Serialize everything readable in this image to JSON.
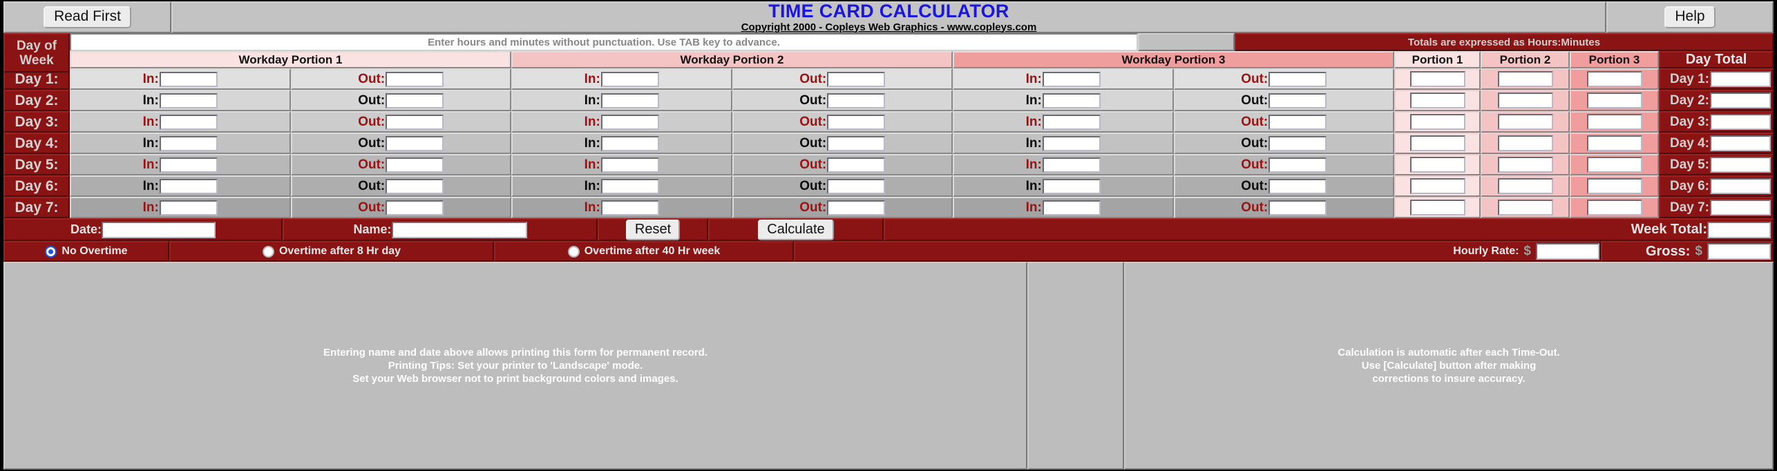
{
  "header": {
    "read_first_label": "Read First",
    "title": "TIME CARD CALCULATOR",
    "copyright": "Copyright 2000 - Copleys Web Graphics - www.copleys.com",
    "help_label": "Help",
    "title_color": "#1a16e0"
  },
  "instructions": {
    "entry_hint": "Enter hours and minutes without punctuation. Use TAB key to advance.",
    "totals_note": "Totals are expressed as Hours:Minutes"
  },
  "columns": {
    "day_of_week": "Day of\nWeek",
    "day_of_week_line1": "Day of",
    "day_of_week_line2": "Week",
    "workday_portions": [
      "Workday Portion 1",
      "Workday Portion 2",
      "Workday Portion 3"
    ],
    "portion_totals": [
      "Portion  1",
      "Portion  2",
      "Portion  3"
    ],
    "day_total": "Day Total",
    "in_label": "In:",
    "out_label": "Out:"
  },
  "rows": [
    {
      "day": "Day  1:",
      "total_label": "Day 1:",
      "label_style": "red",
      "bg": "#e0e0e0",
      "in1": "",
      "out1": "",
      "in2": "",
      "out2": "",
      "in3": "",
      "out3": "",
      "p1": "",
      "p2": "",
      "p3": "",
      "total": ""
    },
    {
      "day": "Day  2:",
      "total_label": "Day 2:",
      "label_style": "black",
      "bg": "#d6d6d6",
      "in1": "",
      "out1": "",
      "in2": "",
      "out2": "",
      "in3": "",
      "out3": "",
      "p1": "",
      "p2": "",
      "p3": "",
      "total": ""
    },
    {
      "day": "Day  3:",
      "total_label": "Day 3:",
      "label_style": "red",
      "bg": "#cccccc",
      "in1": "",
      "out1": "",
      "in2": "",
      "out2": "",
      "in3": "",
      "out3": "",
      "p1": "",
      "p2": "",
      "p3": "",
      "total": ""
    },
    {
      "day": "Day  4:",
      "total_label": "Day 4:",
      "label_style": "black",
      "bg": "#c2c2c2",
      "in1": "",
      "out1": "",
      "in2": "",
      "out2": "",
      "in3": "",
      "out3": "",
      "p1": "",
      "p2": "",
      "p3": "",
      "total": ""
    },
    {
      "day": "Day  5:",
      "total_label": "Day 5:",
      "label_style": "red",
      "bg": "#b8b8b8",
      "in1": "",
      "out1": "",
      "in2": "",
      "out2": "",
      "in3": "",
      "out3": "",
      "p1": "",
      "p2": "",
      "p3": "",
      "total": ""
    },
    {
      "day": "Day  6:",
      "total_label": "Day 6:",
      "label_style": "black",
      "bg": "#aeaeae",
      "in1": "",
      "out1": "",
      "in2": "",
      "out2": "",
      "in3": "",
      "out3": "",
      "p1": "",
      "p2": "",
      "p3": "",
      "total": ""
    },
    {
      "day": "Day  7:",
      "total_label": "Day 7:",
      "label_style": "red",
      "bg": "#a4a4a4",
      "in1": "",
      "out1": "",
      "in2": "",
      "out2": "",
      "in3": "",
      "out3": "",
      "p1": "",
      "p2": "",
      "p3": "",
      "total": ""
    }
  ],
  "actions": {
    "date_label": "Date:",
    "date_value": "",
    "name_label": "Name:",
    "name_value": "",
    "reset_label": "Reset",
    "calculate_label": "Calculate",
    "week_total_label": "Week Total:",
    "week_total_value": ""
  },
  "overtime": {
    "options": [
      {
        "label": "No Overtime",
        "selected": true
      },
      {
        "label": "Overtime after 8 Hr day",
        "selected": false
      },
      {
        "label": "Overtime after 40 Hr week",
        "selected": false
      }
    ],
    "hourly_rate_label": "Hourly Rate:",
    "hourly_rate_value": "",
    "gross_label": "Gross:",
    "gross_value": "",
    "currency": "$"
  },
  "footer": {
    "left": [
      "Entering name and date above allows printing this form for permanent record.",
      "Printing Tips: Set your printer to 'Landscape' mode.",
      "Set your Web browser not to print background colors and images."
    ],
    "right": [
      "Calculation is automatic after each Time-Out.",
      "Use [Calculate] button after making",
      "corrections to insure accuracy."
    ]
  },
  "colors": {
    "maroon": "#8a1313",
    "accent_blue": "#1a16e0",
    "chrome": "#c0c0c0"
  }
}
